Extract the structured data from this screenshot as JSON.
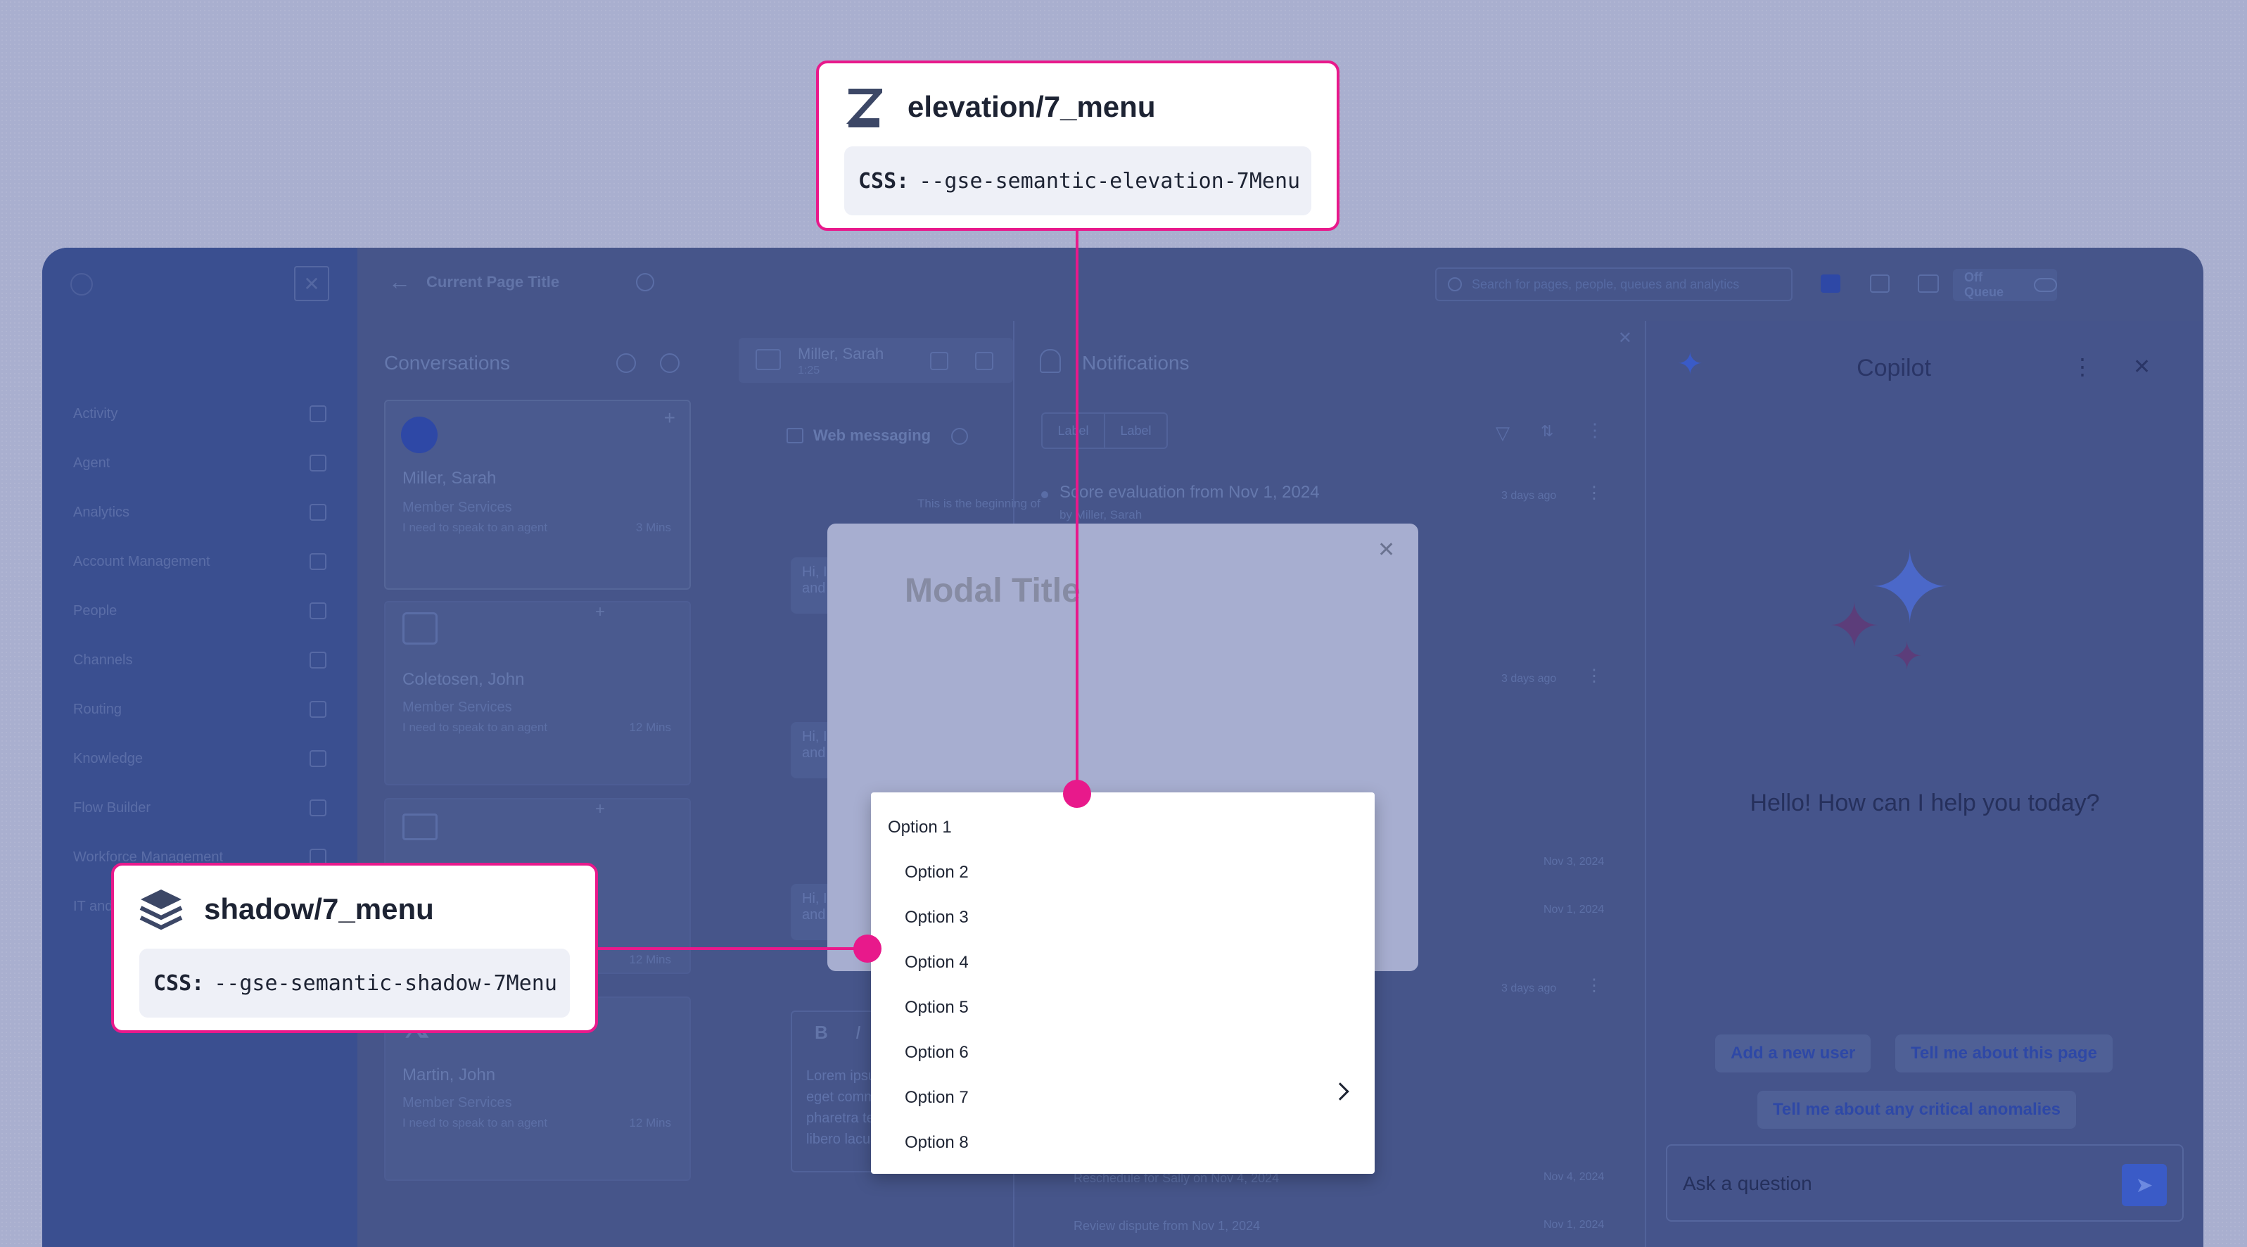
{
  "app": {
    "page_title": "Current Page Title",
    "search_placeholder": "Search for pages, people, queues and analytics",
    "queue_status": "Off Queue"
  },
  "sidebar": {
    "items": [
      {
        "label": "Activity"
      },
      {
        "label": "Agent"
      },
      {
        "label": "Analytics"
      },
      {
        "label": "Account Management"
      },
      {
        "label": "People"
      },
      {
        "label": "Channels"
      },
      {
        "label": "Routing"
      },
      {
        "label": "Knowledge"
      },
      {
        "label": "Flow Builder"
      },
      {
        "label": "Workforce Management"
      },
      {
        "label": "IT and Integrations"
      }
    ]
  },
  "conversations": {
    "title": "Conversations",
    "cards": [
      {
        "name": "Miller, Sarah",
        "queue": "Member Services",
        "message": "I need to speak to an agent",
        "time": "3 Mins"
      },
      {
        "name": "Coletosen, John",
        "queue": "Member Services",
        "message": "I need to speak to an agent",
        "time": "12 Mins"
      },
      {
        "name": "",
        "queue": "",
        "message": "",
        "time": "12 Mins"
      },
      {
        "name": "Martin, John",
        "queue": "Member Services",
        "message": "I need to speak to an agent",
        "time": "12 Mins"
      }
    ]
  },
  "interaction": {
    "name": "Miller, Sarah",
    "sub": "1:25",
    "channel": "Web messaging",
    "beginning": "This is the beginning of",
    "bubble1": "Hi, I need\nand I'm",
    "bubble2": "Hi, I need\nand I'm",
    "bubble3": "Hi, I need\nand I'm",
    "compose": "Lorem ipsum d\neget commodo\npharetra tempo\nlibero lacus ar"
  },
  "notifications": {
    "title": "Notifications",
    "tab1": "Label",
    "tab2": "Label",
    "item1": "Score evaluation from Nov 1, 2024",
    "item1_sub": "by Miller, Sarah",
    "item1_time": "3 days ago",
    "item2_time": "3 days ago",
    "item3_time": "Nov 3, 2024",
    "item4_time": "Nov 1, 2024",
    "item5_time": "3 days ago",
    "item6": "Reschedule for Sally on Nov 4, 2024",
    "item6_time": "Nov 4, 2024",
    "item7": "Review dispute from Nov 1, 2024",
    "item7_time": "Nov 1, 2024"
  },
  "copilot": {
    "title": "Copilot",
    "greeting": "Hello! How can I help you today?",
    "chip1": "Add a new user",
    "chip2": "Tell me about this page",
    "chip3": "Tell me about any critical anomalies",
    "input_placeholder": "Ask a question"
  },
  "modal": {
    "title": "Modal Title"
  },
  "menu": {
    "items": [
      {
        "label": "Option 1"
      },
      {
        "label": "Option 2"
      },
      {
        "label": "Option 3"
      },
      {
        "label": "Option 4"
      },
      {
        "label": "Option 5"
      },
      {
        "label": "Option 6"
      },
      {
        "label": "Option 7"
      },
      {
        "label": "Option 8"
      }
    ]
  },
  "callouts": {
    "elevation": {
      "title": "elevation/7_menu",
      "css_label": "CSS:",
      "css_value": "--gse-semantic-elevation-7Menu",
      "icon": "z-letter-icon"
    },
    "shadow": {
      "title": "shadow/7_menu",
      "css_label": "CSS:",
      "css_value": "--gse-semantic-shadow-7Menu",
      "icon": "layers-icon"
    }
  },
  "colors": {
    "accent": "#e8198b",
    "overlay": "#46558a",
    "menu_bg": "#ffffff",
    "modal_bg": "#a7aed0",
    "copilot_chip_text": "#2e48a6"
  }
}
